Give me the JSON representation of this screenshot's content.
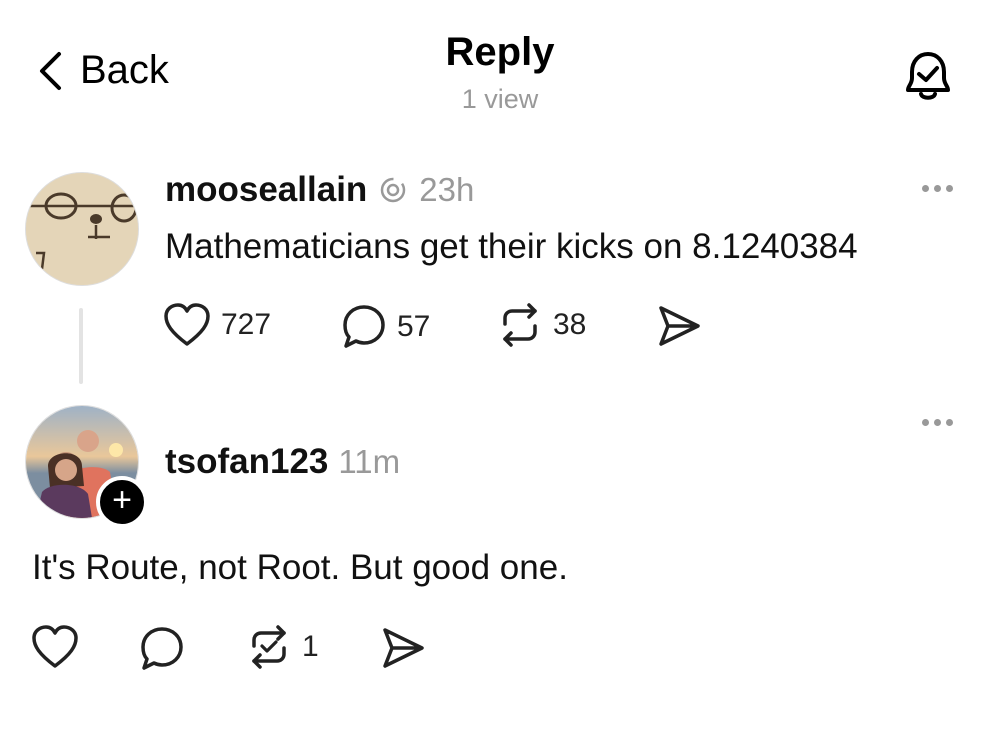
{
  "header": {
    "back_label": "Back",
    "title": "Reply",
    "subtitle": "1 view"
  },
  "posts": [
    {
      "username": "mooseallain",
      "time": "23h",
      "text": "Mathematicians get their kicks on 8.1240384",
      "likes": "727",
      "comments": "57",
      "reposts": "38"
    },
    {
      "username": "tsofan123",
      "time": "11m",
      "text": "It's Route, not Root. But good one.",
      "reposts": "1",
      "follow_symbol": "+"
    }
  ],
  "icons": {
    "back": "chevron-left-icon",
    "bell": "bell-check-icon",
    "like": "heart-icon",
    "comment": "comment-bubble-icon",
    "repost": "repost-icon",
    "share": "send-icon",
    "more": "more-icon"
  },
  "colors": {
    "text": "#000000",
    "muted": "#999999",
    "thread_line": "#e3e3e3"
  }
}
